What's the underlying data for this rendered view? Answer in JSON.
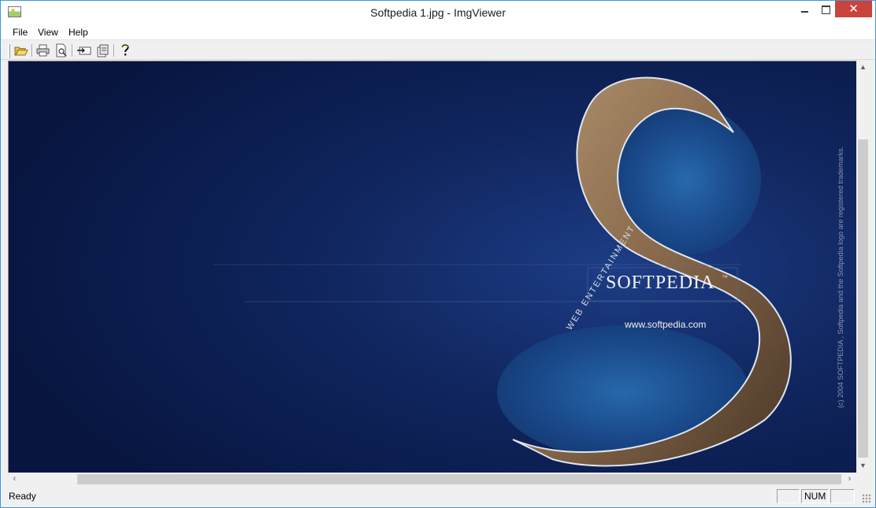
{
  "window": {
    "title": "Softpedia 1.jpg - ImgViewer",
    "close_glyph": "✕"
  },
  "menu": {
    "items": [
      "File",
      "View",
      "Help"
    ]
  },
  "toolbar": {
    "buttons": [
      "open-icon",
      "print-icon",
      "print-preview-icon",
      "export-icon",
      "properties-icon",
      "help-icon"
    ]
  },
  "image": {
    "brand": "SOFTPEDIA",
    "trademark": "™",
    "url": "www.softpedia.com",
    "tagline": "WEB  ENTERTAINMENT",
    "copyright": "(c) 2004  SOFTPEDIA ,  Softpedia and the Softpedia logo are registered trademarks."
  },
  "status": {
    "text": "Ready",
    "panels": [
      "",
      "NUM",
      ""
    ]
  },
  "colors": {
    "accent_border": "#3f96de",
    "close_button": "#c9443d",
    "image_background": "#0c1c4c"
  }
}
